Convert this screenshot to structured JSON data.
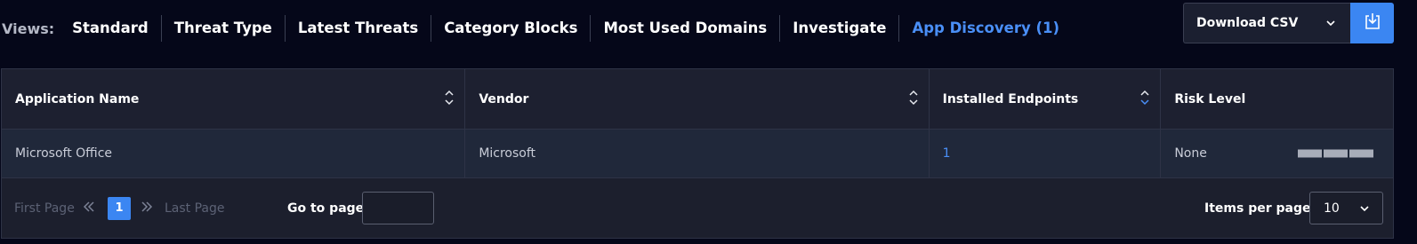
{
  "views": {
    "label": "Views:",
    "tabs": [
      {
        "label": "Standard",
        "active": false
      },
      {
        "label": "Threat Type",
        "active": false
      },
      {
        "label": "Latest Threats",
        "active": false
      },
      {
        "label": "Category Blocks",
        "active": false
      },
      {
        "label": "Most Used Domains",
        "active": false
      },
      {
        "label": "Investigate",
        "active": false
      },
      {
        "label": "App Discovery (1)",
        "active": true
      }
    ]
  },
  "download": {
    "selected": "Download CSV",
    "chevron_icon": "chevron-down-icon",
    "button_icon": "download-icon",
    "accent_color": "#3b86f2"
  },
  "table": {
    "columns": [
      {
        "label": "Application Name",
        "sortable": true,
        "sort_icon": "sort-both-icon"
      },
      {
        "label": "Vendor",
        "sortable": true,
        "sort_icon": "sort-both-icon"
      },
      {
        "label": "Installed Endpoints",
        "sortable": true,
        "sort_icon": "sort-desc-icon"
      },
      {
        "label": "Risk Level",
        "sortable": false
      }
    ],
    "rows": [
      {
        "app": "Microsoft Office",
        "vendor": "Microsoft",
        "endpoints": "1",
        "risk": "None",
        "risk_level": 0,
        "risk_max": 3
      }
    ]
  },
  "pagination": {
    "first_label": "First Page",
    "prev_icon": "double-chevron-left-icon",
    "current_page": "1",
    "next_icon": "double-chevron-right-icon",
    "last_label": "Last Page",
    "goto_label": "Go to page:",
    "goto_value": "",
    "items_per_page_label": "Items per page:",
    "items_per_page": "10"
  }
}
